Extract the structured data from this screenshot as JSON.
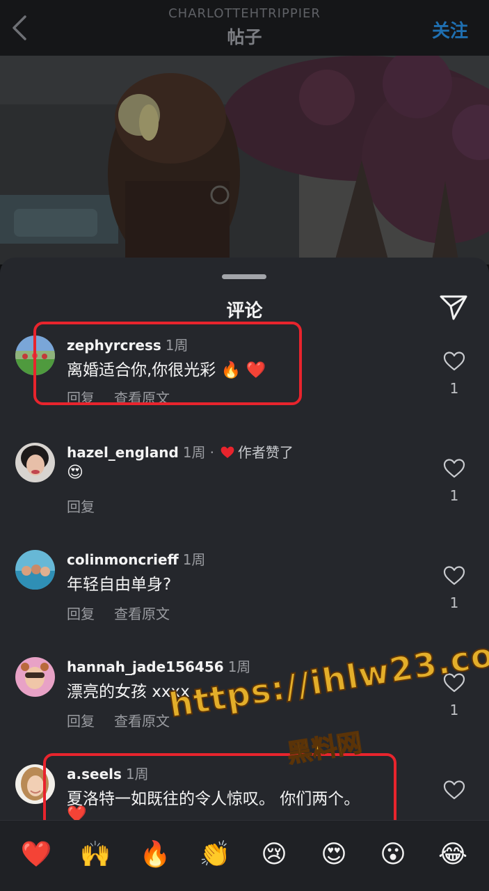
{
  "header": {
    "username": "CHARLOTTEHTRIPPIER",
    "title": "帖子",
    "follow_label": "关注"
  },
  "comments_sheet": {
    "title": "评论"
  },
  "comments": [
    {
      "username": "zephyrcress",
      "time": "1周",
      "text": "离婚适合你,你很光彩 🔥 ❤️",
      "reply_label": "回复",
      "translate_label": "查看原文",
      "likes": "1"
    },
    {
      "username": "hazel_england",
      "time": "1周",
      "author_liked": "作者赞了",
      "text": "😍",
      "reply_label": "回复",
      "likes": "1"
    },
    {
      "username": "colinmoncrieff",
      "time": "1周",
      "text": "年轻自由单身?",
      "reply_label": "回复",
      "translate_label": "查看原文",
      "likes": "1"
    },
    {
      "username": "hannah_jade156456",
      "time": "1周",
      "text": "漂亮的女孩 xxxx",
      "reply_label": "回复",
      "translate_label": "查看原文",
      "likes": "1"
    },
    {
      "username": "a.seels",
      "time": "1周",
      "text": "夏洛特一如既往的令人惊叹。 你们两个。",
      "text_line2": "❤️"
    }
  ],
  "watermark": {
    "url": "https://ihlw23.com",
    "name": "黑料网"
  },
  "emoji_bar": [
    "❤️",
    "🙌",
    "🔥",
    "👏",
    "😢",
    "😍",
    "😮",
    "😂"
  ],
  "colors": {
    "background": "#25272c",
    "follow_blue": "#1f6fb0",
    "heart_red": "#e8242d",
    "highlight_red": "#e8242d"
  }
}
